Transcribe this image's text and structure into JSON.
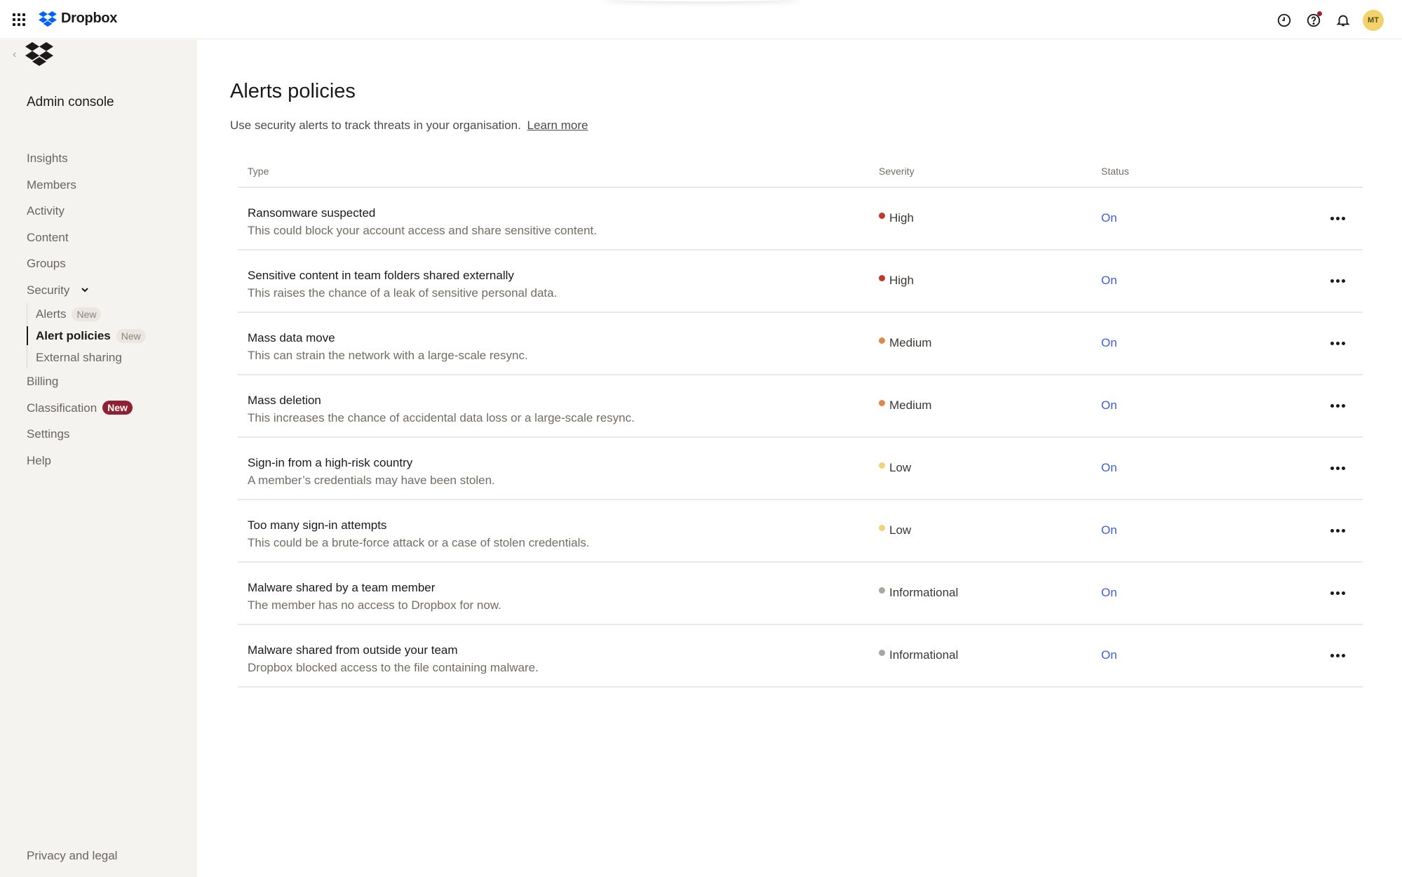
{
  "app": {
    "brand_name": "Dropbox",
    "avatar_initials": "MT",
    "colors": {
      "accent_blue": "#3d5fd9",
      "brand_blue": "#0061fe",
      "new_badge": "#8e2232",
      "avatar": "#f2d36b"
    }
  },
  "topbar": {
    "icons": [
      "apps-grid-icon",
      "dropbox-logo-icon",
      "clock-icon",
      "help-icon",
      "bell-icon"
    ]
  },
  "sidebar": {
    "title": "Admin console",
    "items": [
      {
        "label": "Insights"
      },
      {
        "label": "Members"
      },
      {
        "label": "Activity"
      },
      {
        "label": "Content"
      },
      {
        "label": "Groups"
      },
      {
        "label": "Security",
        "expanded": true,
        "children": [
          {
            "label": "Alerts",
            "badge": "New"
          },
          {
            "label": "Alert policies",
            "badge": "New",
            "active": true
          },
          {
            "label": "External sharing"
          }
        ]
      },
      {
        "label": "Billing"
      },
      {
        "label": "Classification",
        "badge": "New"
      },
      {
        "label": "Settings"
      },
      {
        "label": "Help"
      }
    ],
    "footer_link": "Privacy and legal"
  },
  "main": {
    "title": "Alerts policies",
    "description": "Use security alerts to track threats in your organisation.",
    "learn_more": "Learn more",
    "table": {
      "columns": [
        "Type",
        "Severity",
        "Status"
      ],
      "rows": [
        {
          "title": "Ransomware suspected",
          "desc": "This could block your account access and share sensitive content.",
          "severity": "High",
          "severity_color": "#c0392b",
          "status": "On"
        },
        {
          "title": "Sensitive content in team folders shared externally",
          "desc": "This raises the chance of a leak of sensitive personal data.",
          "severity": "High",
          "severity_color": "#c0392b",
          "status": "On"
        },
        {
          "title": "Mass data move",
          "desc": "This can strain the network with a large-scale resync.",
          "severity": "Medium",
          "severity_color": "#e0884a",
          "status": "On"
        },
        {
          "title": "Mass deletion",
          "desc": "This increases the chance of accidental data loss or a large-scale resync.",
          "severity": "Medium",
          "severity_color": "#e0884a",
          "status": "On"
        },
        {
          "title": "Sign-in from a high-risk country",
          "desc": "A member’s credentials may have been stolen.",
          "severity": "Low",
          "severity_color": "#f3d27a",
          "status": "On"
        },
        {
          "title": "Too many sign-in attempts",
          "desc": "This could be a brute-force attack or a case of stolen credentials.",
          "severity": "Low",
          "severity_color": "#f3d27a",
          "status": "On"
        },
        {
          "title": "Malware shared by a team member",
          "desc": "The member has no access to Dropbox for now.",
          "severity": "Informational",
          "severity_color": "#aaa6a2",
          "status": "On"
        },
        {
          "title": "Malware shared from outside your team",
          "desc": "Dropbox blocked access to the file containing malware.",
          "severity": "Informational",
          "severity_color": "#aaa6a2",
          "status": "On"
        }
      ]
    }
  }
}
